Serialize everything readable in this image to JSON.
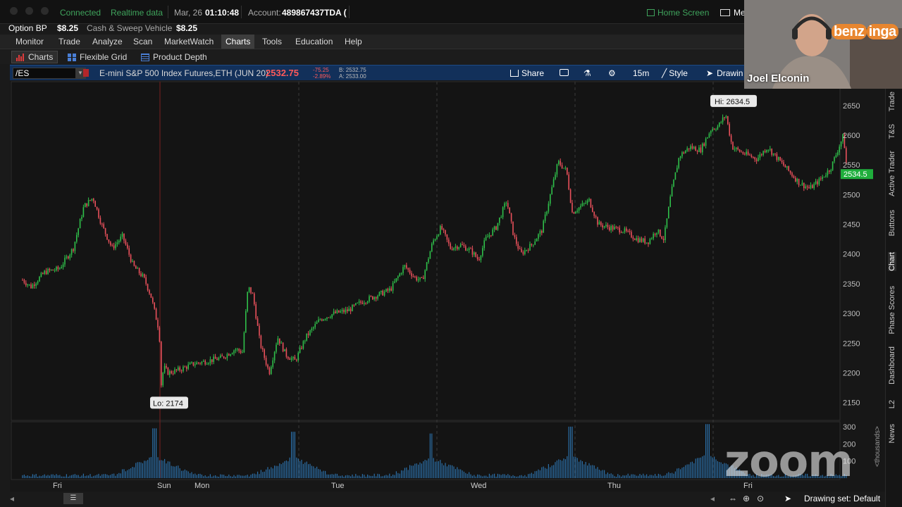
{
  "topbar": {
    "connection": "Connected",
    "data_feed": "Realtime data",
    "date": "Mar, 26",
    "time": "01:10:48",
    "account_label": "Account:",
    "account_value": "489867437TDA (",
    "home_screen": "Home Screen",
    "messages": "Me"
  },
  "balances": {
    "option_bp_label": "Option BP",
    "option_bp_value": "$8.25",
    "cash_label": "Cash & Sweep Vehicle",
    "cash_value": "$8.25"
  },
  "nav": {
    "tabs": [
      "Monitor",
      "Trade",
      "Analyze",
      "Scan",
      "MarketWatch",
      "Charts",
      "Tools",
      "Education",
      "Help"
    ],
    "active": "Charts"
  },
  "subtabs": {
    "charts": "Charts",
    "flexible_grid": "Flexible Grid",
    "product_depth": "Product Depth"
  },
  "chart_header": {
    "symbol": "/ES",
    "description": "E-mini S&P 500 Index Futures,ETH (JUN 20)",
    "last": "2532.75",
    "change": "-75.25",
    "change_pct": "-2.89%",
    "bid": "B: 2532.75",
    "ask": "A: 2533.00",
    "share": "Share",
    "timeframe": "15m",
    "style": "Style",
    "drawings": "Drawin"
  },
  "chart_data": {
    "type": "candlestick",
    "symbol": "/ES",
    "interval": "15m",
    "price_axis": {
      "ticks": [
        2150,
        2200,
        2250,
        2300,
        2350,
        2400,
        2450,
        2500,
        2550,
        2600,
        2650
      ],
      "range": [
        2120,
        2690
      ]
    },
    "volume_axis": {
      "ticks": [
        100,
        200,
        300
      ],
      "unit": "<thousands>",
      "range": [
        0,
        320
      ]
    },
    "time_labels": [
      "Fri",
      "Sun",
      "Mon",
      "Tue",
      "Wed",
      "Thu",
      "Fri"
    ],
    "session_dividers": [
      213,
      410,
      606,
      802,
      998
    ],
    "high_label": "Hi: 2634.5",
    "low_label": "Lo: 2174",
    "high": 2634.5,
    "low": 2174,
    "last_price_label": "2534.5",
    "last_price": 2534.5,
    "price_path": [
      [
        14,
        2360
      ],
      [
        30,
        2345
      ],
      [
        50,
        2370
      ],
      [
        70,
        2375
      ],
      [
        90,
        2410
      ],
      [
        105,
        2480
      ],
      [
        118,
        2495
      ],
      [
        130,
        2450
      ],
      [
        145,
        2410
      ],
      [
        160,
        2430
      ],
      [
        175,
        2380
      ],
      [
        190,
        2360
      ],
      [
        200,
        2330
      ],
      [
        212,
        2270
      ],
      [
        215,
        2174
      ],
      [
        218,
        2210
      ],
      [
        225,
        2200
      ],
      [
        240,
        2205
      ],
      [
        260,
        2215
      ],
      [
        280,
        2220
      ],
      [
        300,
        2225
      ],
      [
        320,
        2240
      ],
      [
        330,
        2235
      ],
      [
        338,
        2345
      ],
      [
        345,
        2330
      ],
      [
        355,
        2250
      ],
      [
        368,
        2200
      ],
      [
        380,
        2260
      ],
      [
        392,
        2230
      ],
      [
        405,
        2220
      ],
      [
        420,
        2260
      ],
      [
        440,
        2290
      ],
      [
        460,
        2300
      ],
      [
        480,
        2305
      ],
      [
        500,
        2320
      ],
      [
        520,
        2330
      ],
      [
        540,
        2340
      ],
      [
        560,
        2380
      ],
      [
        575,
        2360
      ],
      [
        585,
        2355
      ],
      [
        600,
        2420
      ],
      [
        612,
        2445
      ],
      [
        625,
        2410
      ],
      [
        640,
        2415
      ],
      [
        655,
        2405
      ],
      [
        665,
        2390
      ],
      [
        675,
        2425
      ],
      [
        690,
        2445
      ],
      [
        705,
        2490
      ],
      [
        715,
        2430
      ],
      [
        725,
        2400
      ],
      [
        740,
        2415
      ],
      [
        755,
        2440
      ],
      [
        765,
        2490
      ],
      [
        778,
        2555
      ],
      [
        790,
        2540
      ],
      [
        798,
        2470
      ],
      [
        810,
        2480
      ],
      [
        822,
        2490
      ],
      [
        835,
        2450
      ],
      [
        850,
        2445
      ],
      [
        870,
        2440
      ],
      [
        890,
        2425
      ],
      [
        905,
        2420
      ],
      [
        918,
        2440
      ],
      [
        928,
        2425
      ],
      [
        938,
        2500
      ],
      [
        950,
        2565
      ],
      [
        965,
        2580
      ],
      [
        980,
        2575
      ],
      [
        995,
        2610
      ],
      [
        1005,
        2615
      ],
      [
        1016,
        2634.5
      ],
      [
        1025,
        2580
      ],
      [
        1040,
        2570
      ],
      [
        1060,
        2560
      ],
      [
        1075,
        2580
      ],
      [
        1090,
        2560
      ],
      [
        1105,
        2540
      ],
      [
        1120,
        2520
      ],
      [
        1135,
        2510
      ],
      [
        1150,
        2525
      ],
      [
        1165,
        2545
      ],
      [
        1183,
        2600
      ],
      [
        1188,
        2534.5
      ]
    ],
    "volume_spikes": [
      [
        205,
        290
      ],
      [
        402,
        270
      ],
      [
        598,
        260
      ],
      [
        795,
        300
      ],
      [
        990,
        315
      ]
    ]
  },
  "right_panel": {
    "tabs": [
      "Trade",
      "T&S",
      "Active Trader",
      "Buttons",
      "Chart",
      "Phase Scores",
      "Dashboard",
      "L2",
      "News"
    ],
    "active": "Chart"
  },
  "webcam": {
    "presenter": "Joel Elconin",
    "brand_left": "benz",
    "brand_right": "inga"
  },
  "watermark": "zoom",
  "status": {
    "drawing_set": "Drawing set: Default"
  },
  "colors": {
    "up": "#2fbf4a",
    "down": "#e8505b",
    "last_price_bg": "#1fae3c",
    "header_bg": "#12305a"
  },
  "icons": [
    "share-icon",
    "camera-icon",
    "flask-icon",
    "gear-icon",
    "style-icon",
    "cursor-icon",
    "envelope-icon",
    "home-icon",
    "zoom-in-icon",
    "crosshair-icon",
    "pan-icon"
  ]
}
